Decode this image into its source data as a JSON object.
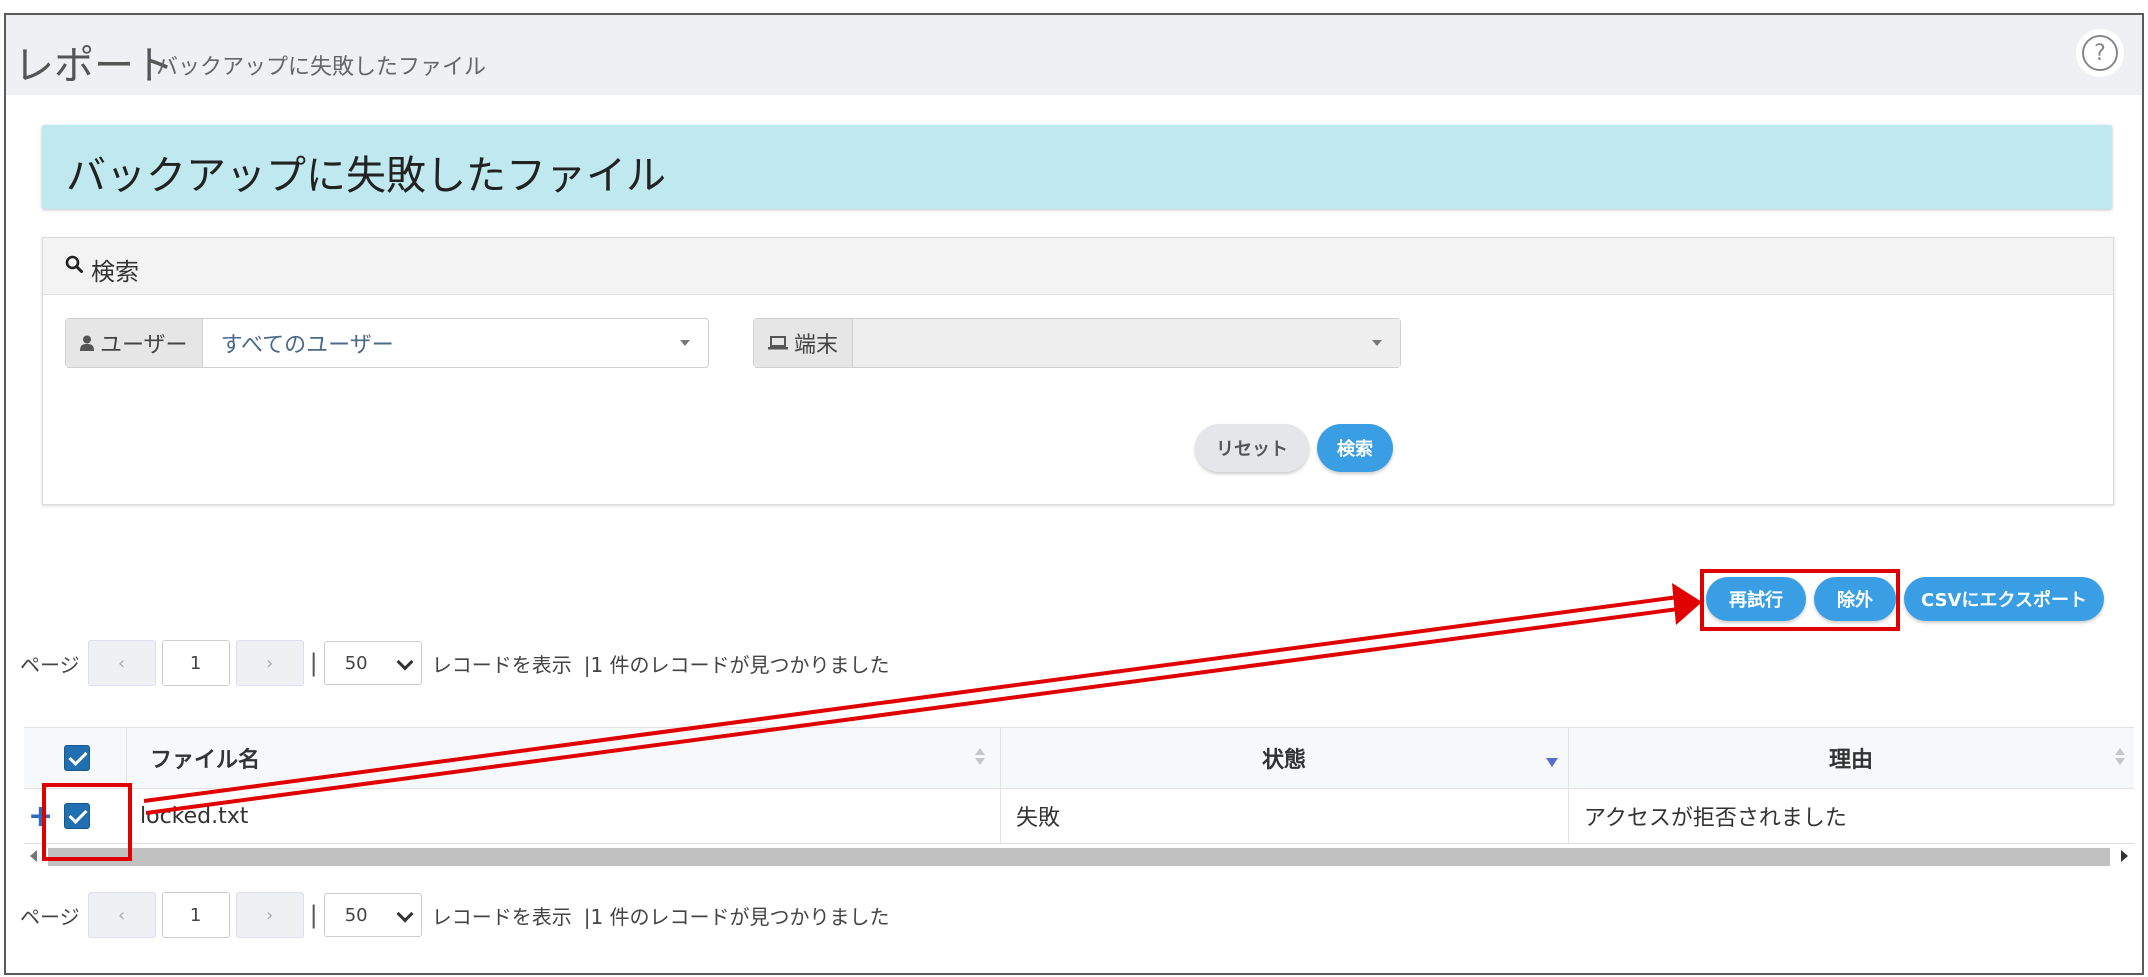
{
  "header": {
    "title": "レポート",
    "subtitle": "バックアップに失敗したファイル",
    "help_icon": "?"
  },
  "banner": {
    "title": "バックアップに失敗したファイル"
  },
  "search": {
    "title": "検索",
    "user_label": "ユーザー",
    "user_value": "すべてのユーザー",
    "device_label": "端末",
    "device_value": "",
    "reset_label": "リセット",
    "search_label": "検索"
  },
  "actions": {
    "retry_label": "再試行",
    "exclude_label": "除外",
    "export_label": "CSVにエクスポート"
  },
  "pager_top": {
    "page_label": "ページ",
    "prev": "‹",
    "page": "1",
    "next": "›",
    "sep": "|",
    "page_size": "50",
    "records_label": "レコードを表示",
    "found_text": "|1 件のレコードが見つかりました"
  },
  "pager_bottom": {
    "page_label": "ページ",
    "prev": "‹",
    "page": "1",
    "next": "›",
    "sep": "|",
    "page_size": "50",
    "records_label": "レコードを表示",
    "found_text": "|1 件のレコードが見つかりました"
  },
  "table": {
    "columns": [
      "ファイル名",
      "状態",
      "理由"
    ],
    "rows": [
      {
        "expand": "+",
        "file": "locked.txt",
        "status": "失敗",
        "reason": "アクセスが拒否されました"
      }
    ]
  },
  "colors": {
    "accent": "#3a9ee4",
    "banner": "#bfe9ef",
    "highlight": "#e00000",
    "checkbox": "#1f6fb1"
  }
}
